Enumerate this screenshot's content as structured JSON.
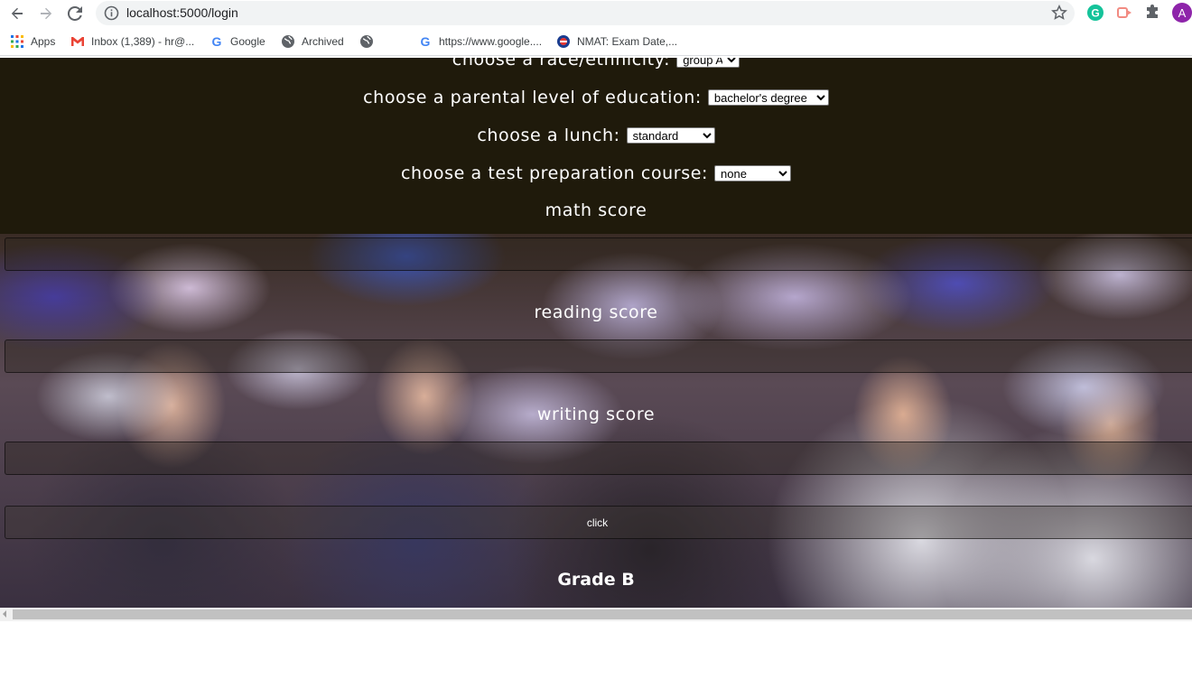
{
  "browser": {
    "url": "localhost:5000/login",
    "bookmarks": [
      {
        "label": "Apps",
        "icon": "apps-grid-icon"
      },
      {
        "label": "Inbox (1,389) - hr@...",
        "icon": "gmail-icon"
      },
      {
        "label": "Google",
        "icon": "google-icon"
      },
      {
        "label": "Archived",
        "icon": "globe-icon"
      },
      {
        "label": "",
        "icon": "globe-icon"
      },
      {
        "label": "https://www.google....",
        "icon": "google-icon"
      },
      {
        "label": "NMAT: Exam Date,...",
        "icon": "nmat-icon"
      }
    ],
    "profile_initial": "A",
    "colors": {
      "grammarly": "#15c39a",
      "profile": "#8e24aa"
    }
  },
  "form": {
    "race_label": "choose a race/ethnicity:",
    "race_value": "group A",
    "parent_label": "choose a parental level of education:",
    "parent_value": "bachelor's degree",
    "lunch_label": "choose a lunch:",
    "lunch_value": "standard",
    "prep_label": "choose a test preparation course:",
    "prep_value": "none",
    "math_label": "math score",
    "reading_label": "reading score",
    "writing_label": "writing score",
    "submit_label": "click",
    "result": "Grade B"
  }
}
